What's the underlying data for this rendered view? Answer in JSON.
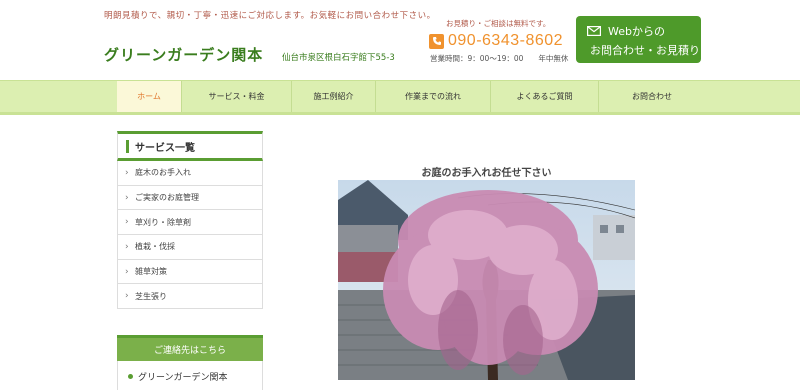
{
  "header": {
    "tagline": "明朗見積りで、親切・丁寧・迅速にご対応します。お気軽にお問い合わせ下さい。",
    "site_title": "グリーンガーデン関本",
    "address": "仙台市泉区根白石字館下55-3",
    "estimate_note": "お見積り・ご相談は無料です。",
    "phone": "090-6343-8602",
    "hours": "営業時間：9：00〜19：00　　年中無休",
    "contact_button": {
      "line1": "Webからの",
      "line2": "お問合わせ・お見積り"
    }
  },
  "nav": {
    "items": [
      {
        "label": "ホーム",
        "active": true
      },
      {
        "label": "サービス・料金",
        "active": false
      },
      {
        "label": "施工例紹介",
        "active": false
      },
      {
        "label": "作業までの流れ",
        "active": false
      },
      {
        "label": "よくあるご質問",
        "active": false
      },
      {
        "label": "お問合わせ",
        "active": false
      }
    ]
  },
  "sidebar": {
    "title": "サービス一覧",
    "items": [
      {
        "label": "庭木のお手入れ"
      },
      {
        "label": "ご実家のお庭管理"
      },
      {
        "label": "草刈り・除草剤"
      },
      {
        "label": "植栽・伐採"
      },
      {
        "label": "雑草対策"
      },
      {
        "label": "芝生張り"
      }
    ]
  },
  "contact_box": {
    "title": "ご連絡先はこちら",
    "name": "グリーンガーデン関本"
  },
  "main": {
    "heading": "お庭のお手入れお任せ下さい"
  },
  "colors": {
    "brand_green": "#3a7d1e",
    "nav_bg": "#dcefb1",
    "accent_orange": "#f0922e",
    "button_green": "#4e9a2a"
  }
}
